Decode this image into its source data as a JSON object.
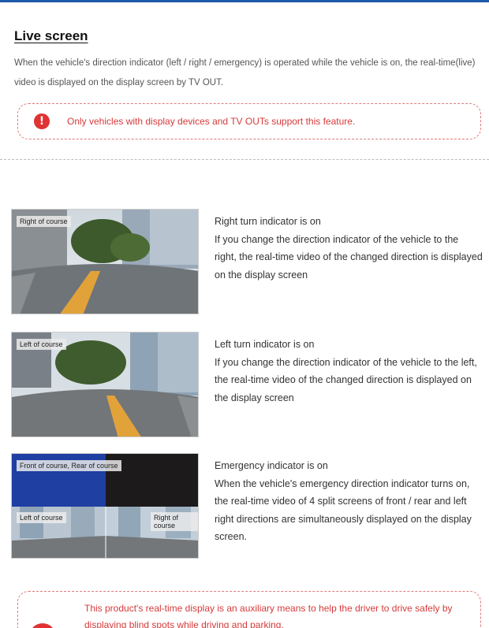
{
  "section": {
    "title": "Live screen",
    "intro": "When the vehicle's direction indicator (left / right / emergency) is operated while the vehicle is on, the real-time(live) video is displayed on the display screen by TV OUT."
  },
  "note": {
    "icon": "exclamation-icon",
    "text": "Only vehicles with display devices and TV OUTs support this feature."
  },
  "items": [
    {
      "caption": "Right of course",
      "heading": "Right turn indicator is on",
      "body": "If you change the direction indicator of the vehicle to the right, the real-time video of the changed direction is displayed on the display screen"
    },
    {
      "caption": "Left of course",
      "heading": "Left turn indicator is on",
      "body": "If you change the direction indicator of the vehicle to the left, the real-time video of the changed direction is displayed on the display screen"
    },
    {
      "caption_top": "Front of course,  Rear of course",
      "caption_left": "Left of course",
      "caption_right": "Right of course",
      "heading": "Emergency indicator is on",
      "body": "When the vehicle's emergency direction indicator turns on, the real-time video of 4 split screens of front / rear and left right directions are simultaneously displayed on the display screen."
    }
  ],
  "bottom_note": {
    "icon": "exclamation-icon",
    "text": "This product's real-time display is an auxiliary means to help the driver to drive safely by displaying blind spots while driving and parking."
  },
  "colors": {
    "accent": "#1e5aa8",
    "warning": "#e03232",
    "split_blue": "#1f3fa3",
    "split_dark": "#1c1a1a"
  }
}
